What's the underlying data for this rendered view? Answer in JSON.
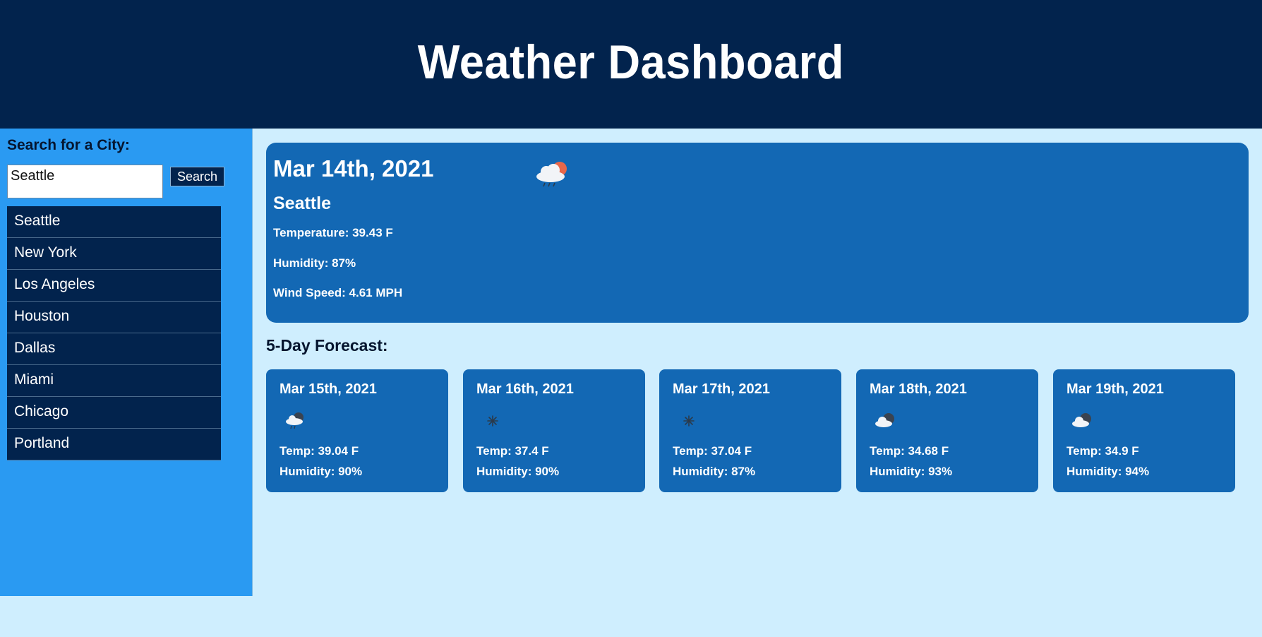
{
  "header": {
    "title": "Weather Dashboard"
  },
  "sidebar": {
    "search_title": "Search for a City:",
    "search_value": "Seattle",
    "search_button": "Search",
    "cities": [
      "Seattle",
      "New York",
      "Los Angeles",
      "Houston",
      "Dallas",
      "Miami",
      "Chicago",
      "Portland"
    ]
  },
  "current": {
    "date": "Mar 14th, 2021",
    "icon": "rain-cloud-sun-icon",
    "city": "Seattle",
    "temperature": "Temperature: 39.43 F",
    "humidity": "Humidity: 87%",
    "wind": "Wind Speed: 4.61 MPH"
  },
  "forecast": {
    "title": "5-Day Forecast:",
    "days": [
      {
        "date": "Mar 15th, 2021",
        "icon": "rain-cloud-icon",
        "temp": "Temp: 39.04 F",
        "humidity": "Humidity: 90%"
      },
      {
        "date": "Mar 16th, 2021",
        "icon": "snowflake-icon",
        "temp": "Temp: 37.4 F",
        "humidity": "Humidity: 90%"
      },
      {
        "date": "Mar 17th, 2021",
        "icon": "snowflake-icon",
        "temp": "Temp: 37.04 F",
        "humidity": "Humidity: 87%"
      },
      {
        "date": "Mar 18th, 2021",
        "icon": "partly-cloudy-night-icon",
        "temp": "Temp: 34.68 F",
        "humidity": "Humidity: 93%"
      },
      {
        "date": "Mar 19th, 2021",
        "icon": "partly-cloudy-night-icon",
        "temp": "Temp: 34.9 F",
        "humidity": "Humidity: 94%"
      }
    ]
  },
  "colors": {
    "header_bg": "#02234d",
    "sidebar_bg": "#2a9af2",
    "card_bg": "#1368b4",
    "page_bg": "#cfeefe"
  }
}
